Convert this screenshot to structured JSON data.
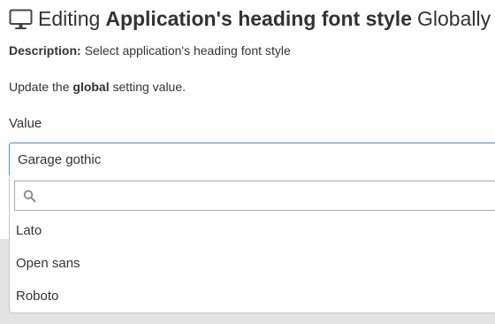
{
  "header": {
    "icon": "monitor-icon",
    "prefix": "Editing",
    "setting_name": "Application's heading font style",
    "suffix": "Globally"
  },
  "description": {
    "label": "Description:",
    "text": "Select application's heading font style"
  },
  "update": {
    "before": "Update the ",
    "emphasis": "global",
    "after": " setting value."
  },
  "field": {
    "label": "Value",
    "selected": "Garage gothic"
  },
  "dropdown": {
    "search_value": "",
    "search_icon": "search-icon",
    "options": [
      {
        "label": "Lato"
      },
      {
        "label": "Open sans"
      },
      {
        "label": "Roboto"
      }
    ]
  },
  "colors": {
    "focus_border": "#4a90c2",
    "text": "#333333",
    "backdrop": "#e3e3e3"
  }
}
